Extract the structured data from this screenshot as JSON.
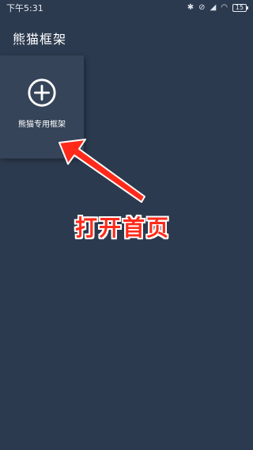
{
  "status_bar": {
    "time": "下午5:31",
    "battery": "15",
    "icons": [
      "bluetooth-icon",
      "alarm-off-icon",
      "signal-icon",
      "wifi-icon",
      "battery-icon"
    ]
  },
  "app": {
    "title": "熊猫框架"
  },
  "tile": {
    "icon": "plus-circle-icon",
    "label": "熊猫专用框架"
  },
  "annotation": {
    "text": "打开首页",
    "color": "#ff2a1a"
  },
  "colors": {
    "background": "#2c3a4f",
    "tile": "#354459"
  }
}
